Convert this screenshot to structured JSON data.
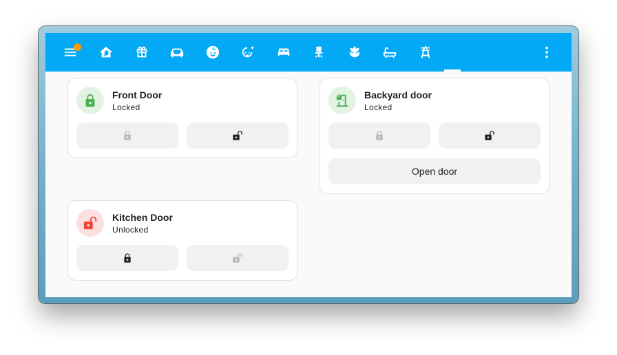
{
  "toolbar": {
    "icons": [
      "menu-icon",
      "home-leaf-icon",
      "gift-icon",
      "sofa-icon",
      "baby-face-icon",
      "face-sparkle-icon",
      "bed-icon",
      "desk-chair-icon",
      "flower-icon",
      "bathtub-icon",
      "transmission-tower-icon",
      "more-vert-icon"
    ],
    "accent_color": "#03a9f4",
    "notification_color": "#ff9800"
  },
  "cards": {
    "front": {
      "name": "Front Door",
      "state": "Locked",
      "icon": "lock-icon",
      "color": "#4caf50"
    },
    "backyard": {
      "name": "Backyard door",
      "state": "Locked",
      "icon": "door-closed-lock-icon",
      "color": "#4caf50",
      "open_label": "Open door"
    },
    "kitchen": {
      "name": "Kitchen Door",
      "state": "Unlocked",
      "icon": "lock-open-icon",
      "color": "#f44336"
    }
  }
}
